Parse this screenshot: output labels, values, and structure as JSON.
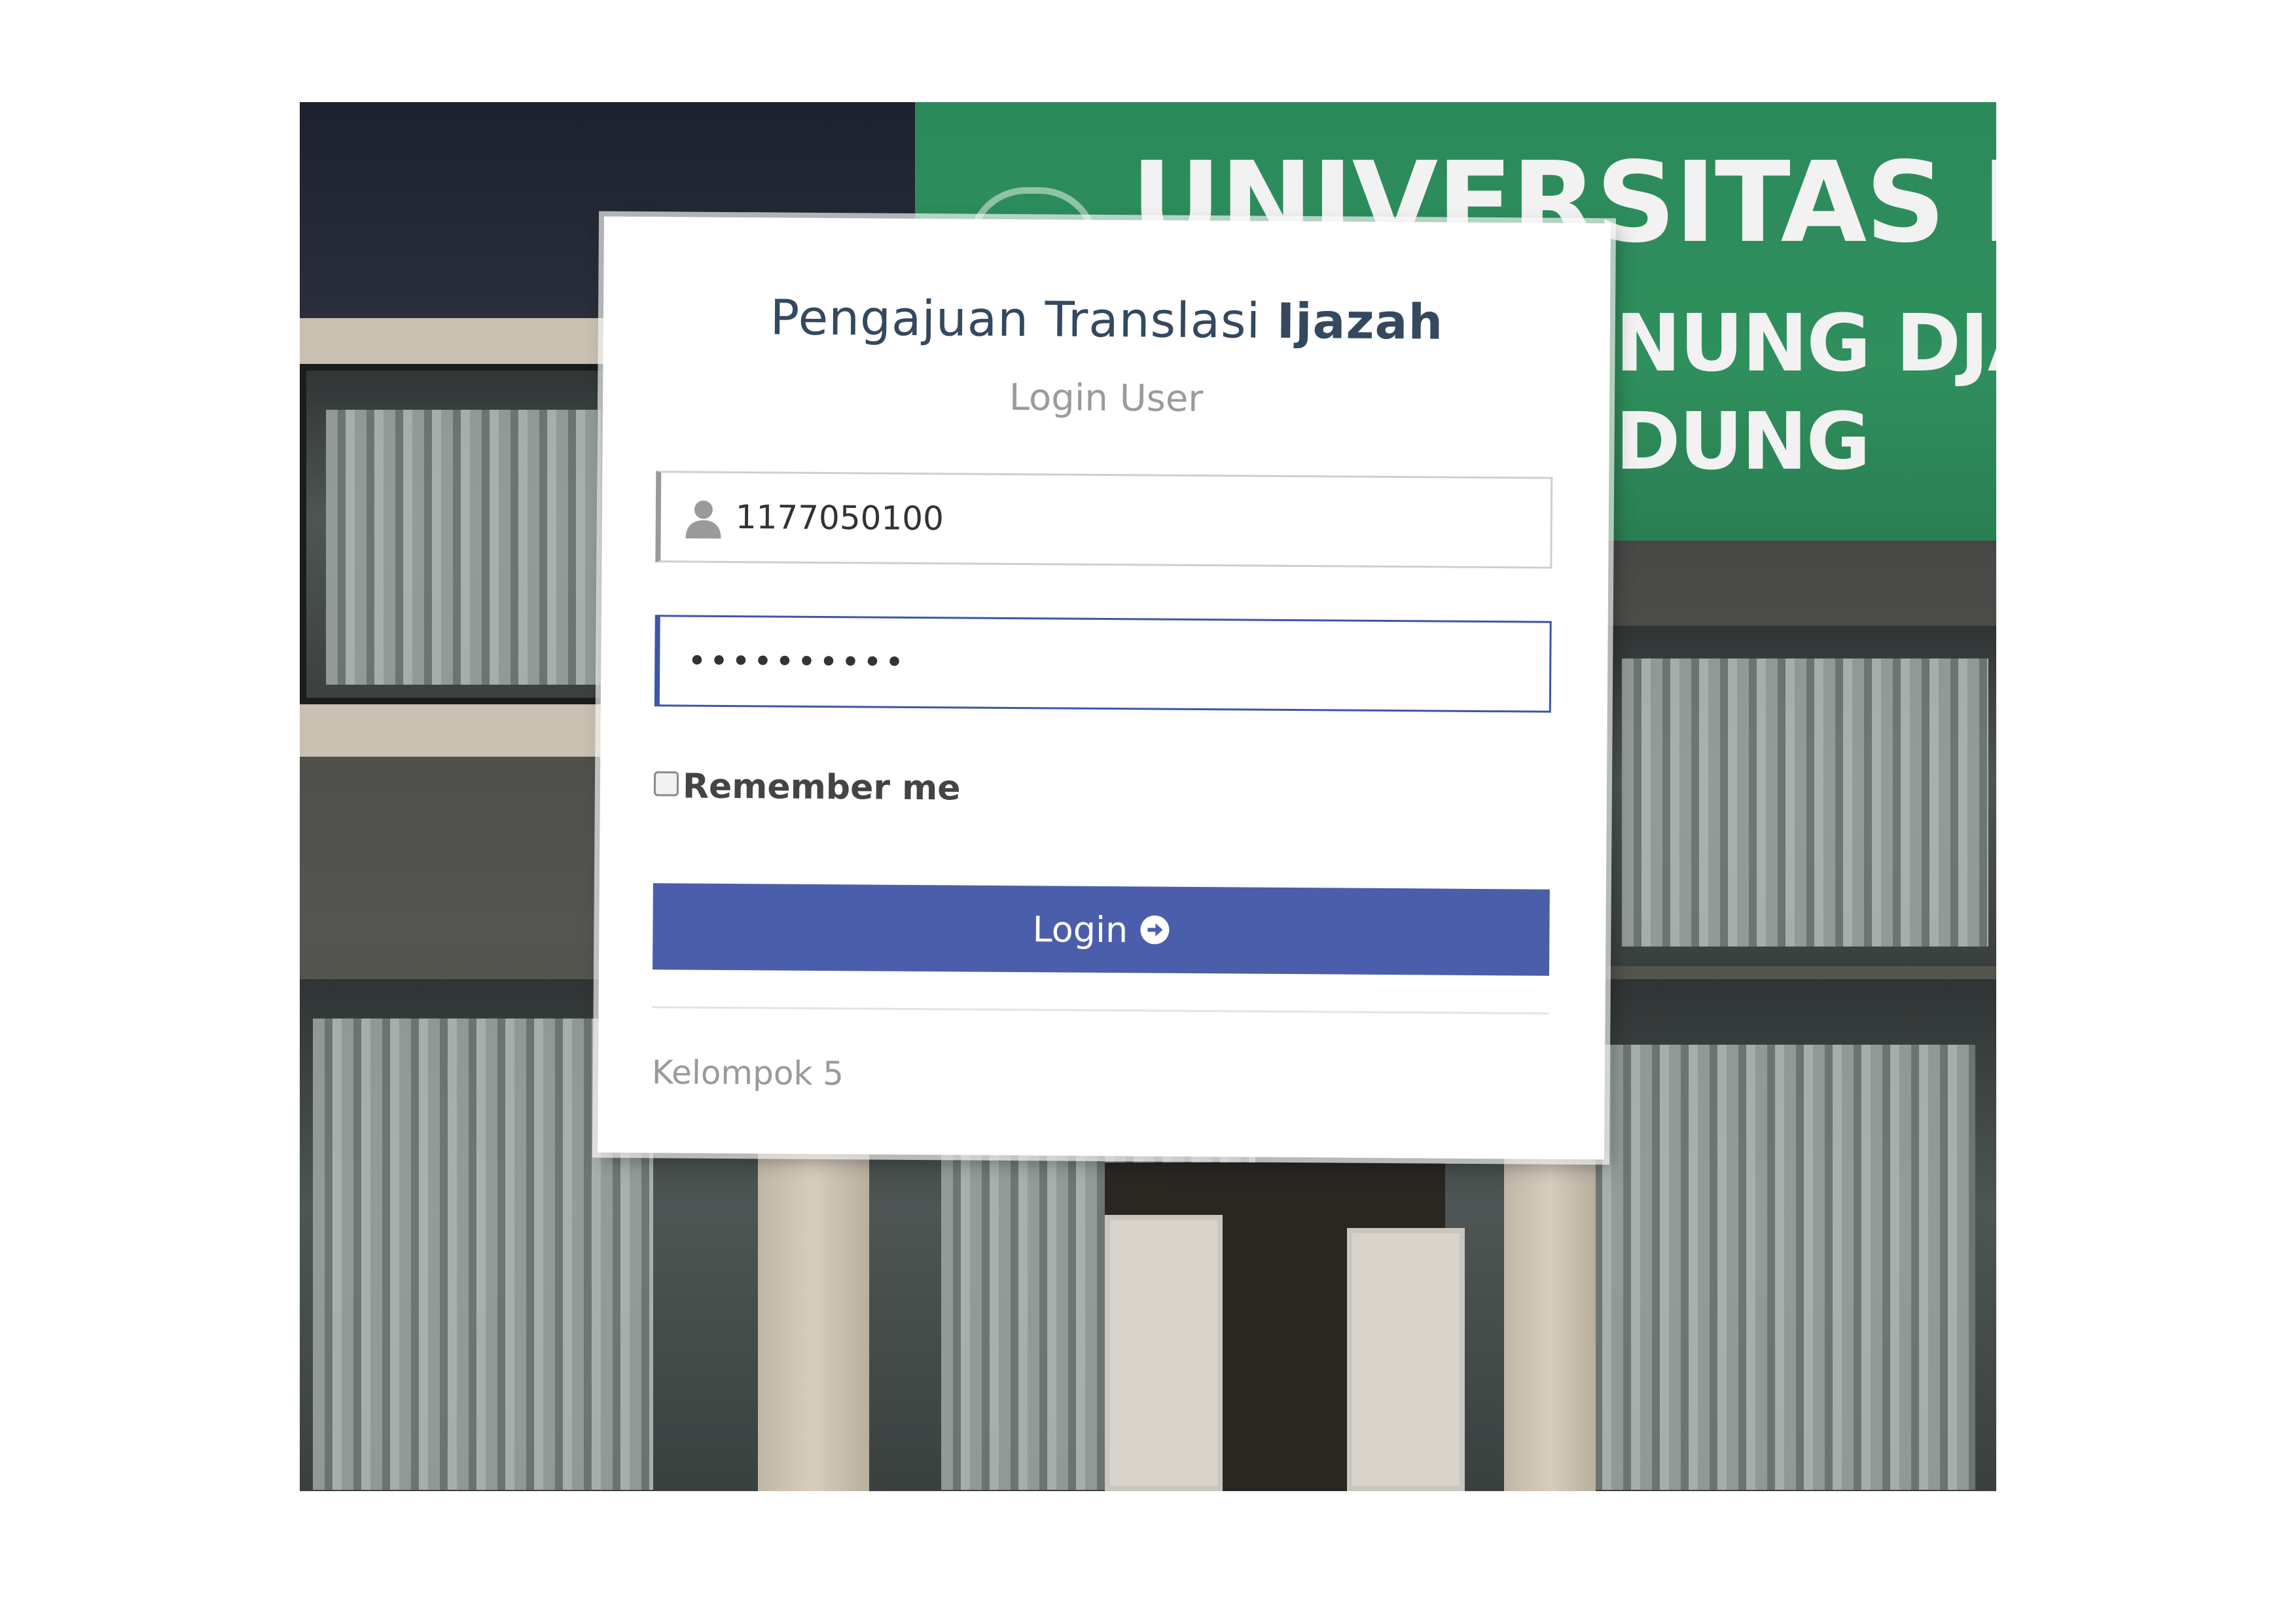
{
  "background": {
    "sign_lines": [
      "UNIVERSITAS ISLAM NEG",
      "NUNG DJAT",
      "DUNG"
    ]
  },
  "login": {
    "title_regular": "Pengajuan Translasi ",
    "title_bold": "Ijazah",
    "subtitle": "Login User",
    "username_value": "1177050100",
    "password_mask": "••••••••••",
    "remember_label": "Remember me",
    "remember_checked": false,
    "button_label": "Login",
    "footer": "Kelompok 5"
  },
  "colors": {
    "accent": "#4a5eab",
    "focus_border": "#3b57a8",
    "title": "#34495e",
    "muted_text": "#9b9b9b"
  },
  "icons": [
    "user-icon",
    "arrow-circle-right-icon"
  ]
}
